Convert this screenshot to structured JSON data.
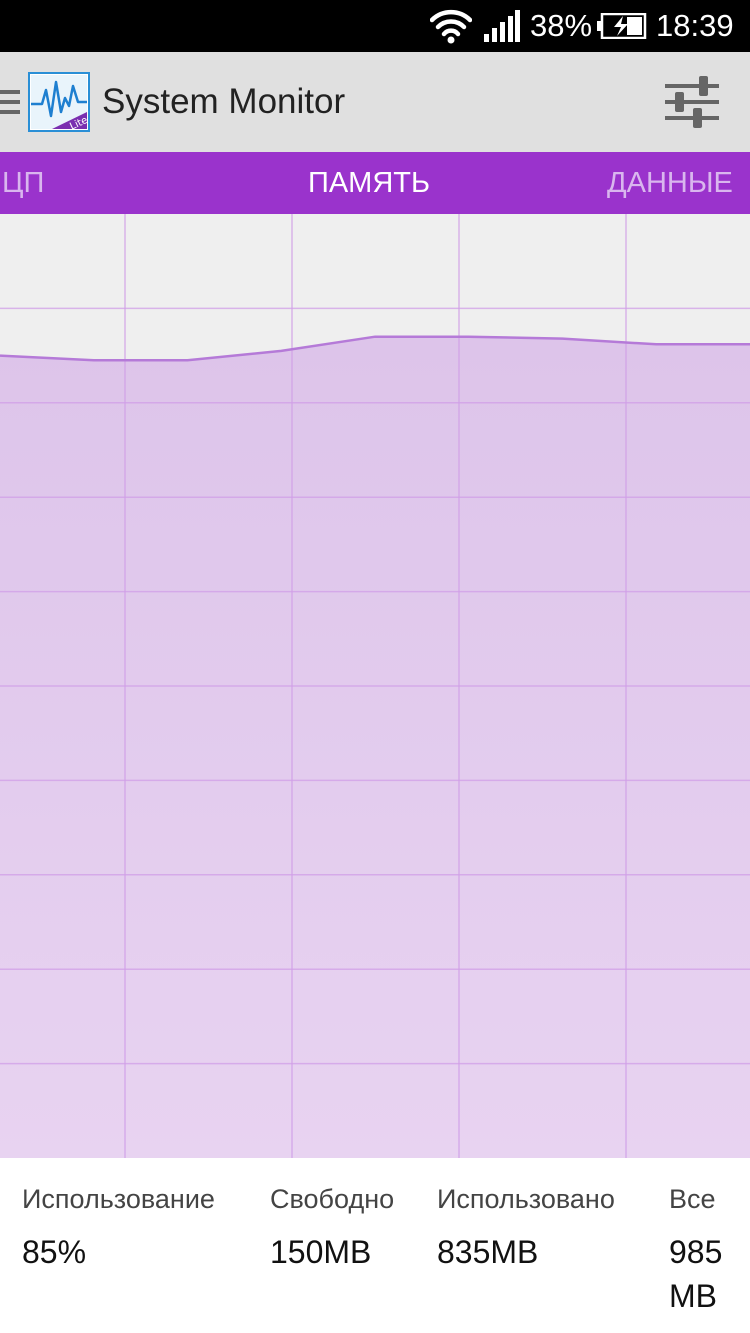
{
  "status_bar": {
    "battery_percent": "38%",
    "time": "18:39",
    "icons": [
      "wifi-icon",
      "signal-icon",
      "battery-charging-icon"
    ]
  },
  "app_bar": {
    "title": "System Monitor",
    "logo_badge": "Lite",
    "icons": [
      "drawer-menu-icon",
      "app-logo-icon",
      "settings-sliders-icon"
    ]
  },
  "tabs": [
    {
      "label": "ЦП",
      "selected": false
    },
    {
      "label": "ПАМЯТЬ",
      "selected": true
    },
    {
      "label": "ДАННЫЕ",
      "selected": false
    }
  ],
  "colors": {
    "accent": "#9a33cc",
    "chart_fill": "#dcc3e8",
    "chart_line": "#b57ad8",
    "grid": "#d19fe8",
    "chart_bg": "#efefef"
  },
  "chart_data": {
    "type": "area",
    "series": [
      {
        "values": [
          85,
          84.5,
          84.5,
          85.5,
          87,
          87,
          86.8,
          86.2,
          86.2
        ]
      }
    ],
    "ylim": [
      0,
      100
    ],
    "grid": true
  },
  "stats": {
    "usage": {
      "label": "Использование",
      "value": "85%"
    },
    "free": {
      "label": "Свободно",
      "value": "150MB"
    },
    "used": {
      "label": "Использовано",
      "value": "835MB"
    },
    "total": {
      "label": "Все",
      "value": "985 MB"
    }
  }
}
